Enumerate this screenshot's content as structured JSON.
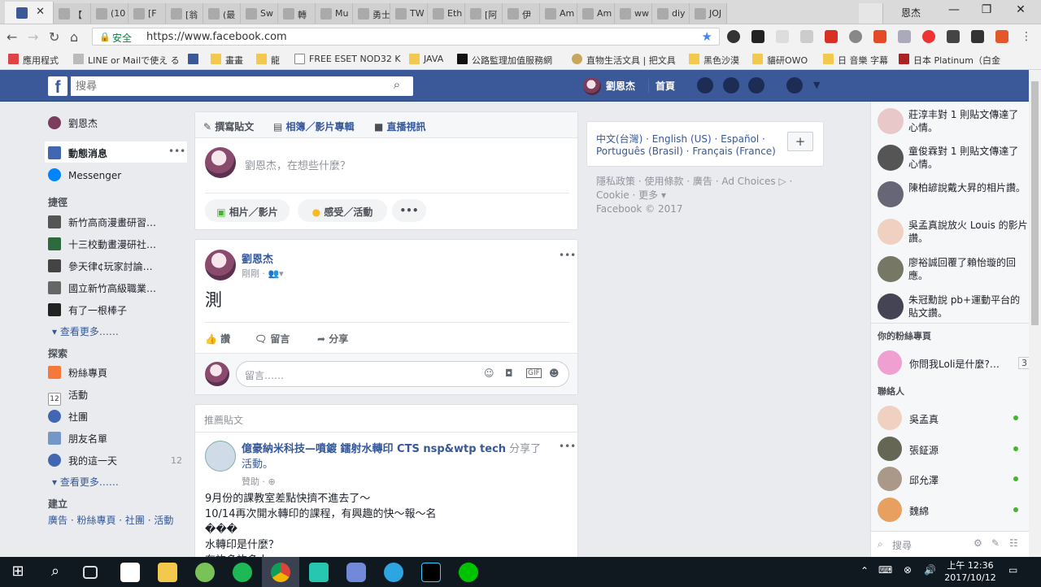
{
  "browser": {
    "tabs": [
      {
        "label": "",
        "active": true
      },
      {
        "label": "【"
      },
      {
        "label": "(10"
      },
      {
        "label": "[F"
      },
      {
        "label": "[翁"
      },
      {
        "label": "(最"
      },
      {
        "label": "Sw"
      },
      {
        "label": "轉"
      },
      {
        "label": "Mu"
      },
      {
        "label": "勇士"
      },
      {
        "label": "TW"
      },
      {
        "label": "Eth"
      },
      {
        "label": "[阿"
      },
      {
        "label": "伊"
      },
      {
        "label": "Am"
      },
      {
        "label": "Am"
      },
      {
        "label": "ww"
      },
      {
        "label": "diy"
      },
      {
        "label": "JOJ"
      }
    ],
    "tab_close": "✕",
    "profile_name": "恩杰",
    "win": {
      "min": "—",
      "max": "❐",
      "close": "✕"
    },
    "nav": {
      "back": "←",
      "forward": "→",
      "reload": "↻",
      "home": "⌂"
    },
    "secure_label": "安全",
    "url": "https://www.facebook.com",
    "bookmarks": [
      "應用程式",
      "LINE or Mailで使え る",
      "",
      "畫畫",
      "龍",
      "FREE ESET NOD32 K",
      "JAVA",
      "公路監理加值服務網",
      "直物生活文具 | 把文具",
      "黑色沙漠",
      "貓研OWO",
      "日 音樂 字幕",
      "日本 Platinum（白金"
    ]
  },
  "facebook": {
    "search_placeholder": "搜尋",
    "user_name": "劉恩杰",
    "home_label": "首頁",
    "left": {
      "profile": "劉恩杰",
      "news_feed": "動態消息",
      "messenger": "Messenger",
      "shortcuts_header": "捷徑",
      "shortcuts": [
        "新竹高商漫畫研習…",
        "十三校動畫漫研社…",
        "參天律¢玩家討論…",
        "國立新竹高級職業…",
        "有了一根棒子"
      ],
      "see_more": "▾ 查看更多……",
      "explore_header": "探索",
      "explore": [
        "粉絲專頁",
        "活動",
        "社團",
        "朋友名單",
        "我的這一天"
      ],
      "events_day": "12",
      "memories_count": "12",
      "see_more2": "▾ 查看更多……",
      "create_header": "建立",
      "create_links": "廣告 · 粉絲專頁 · 社團 · 活動"
    },
    "composer": {
      "tab_write": "撰寫貼文",
      "tab_album": "相簿／影片專輯",
      "tab_live": "直播視訊",
      "prompt": "劉恩杰，在想些什麼？",
      "photo": "相片／影片",
      "feeling": "感受／活動",
      "more": "•••"
    },
    "post": {
      "author": "劉恩杰",
      "time": "剛剛 · 👥▾",
      "text": "測",
      "like": "讚",
      "comment": "留言",
      "share": "分享",
      "comment_placeholder": "留言……",
      "menu": "•••"
    },
    "suggested": {
      "header": "推薦貼文",
      "author": "億豪納米科技—噴鍍 鐳射水轉印 CTS nsp&wtp tech",
      "shared": " 分享了",
      "activity": "活動。",
      "sponsored": "贊助 · ⊕",
      "lines": [
        "9月份的課教室差點快擠不進去了～",
        "10/14再次開水轉印的課程，有興趣的快～報～名",
        "���",
        "水轉印是什麼？",
        "有許多許多人..."
      ]
    },
    "lang": {
      "line1": "中文(台灣) · English (US) · Español ·",
      "line2": "Português (Brasil) · Français (France)",
      "plus": "+"
    },
    "footer": {
      "l1": "隱私政策 · 使用條款 · 廣告 · Ad Choices ▷ ·",
      "l2": "Cookie · 更多 ▾",
      "l3": "Facebook © 2017"
    },
    "ticker": [
      "莊淳丰對 1 則貼文傳達了心情。",
      "童俊霖對 1 則貼文傳達了心情。",
      "陳柏諺說戴大昇的相片讚。",
      "吳孟真說放火 Louis 的影片讚。",
      "廖裕誠回覆了賴怡璇的回應。",
      "朱冠勳說 pb+運動平台的貼文讚。"
    ],
    "fan_header": "你的粉絲專頁",
    "fan_page": "你問我Loli是什麼?…",
    "fan_count": "3",
    "contacts_header": "聯絡人",
    "contacts": [
      "吳孟真",
      "張鉦源",
      "邱允澤",
      "魏綿"
    ],
    "chat_search": "搜尋"
  },
  "taskbar": {
    "time": "上午 12:36",
    "date": "2017/10/12"
  }
}
